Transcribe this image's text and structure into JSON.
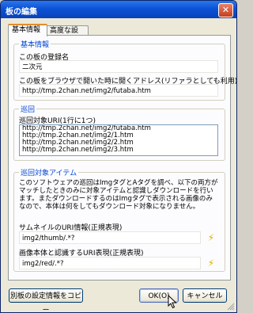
{
  "window": {
    "title": "板の編集",
    "close_label": "✕"
  },
  "tabs": [
    {
      "label": "基本情報",
      "active": true
    },
    {
      "label": "高度な設定",
      "active": false
    }
  ],
  "basic": {
    "group_title": "基本情報",
    "name_label": "この板の登録名",
    "name_value": "二次元",
    "url_label": "この板をブラウザで開いた時に開くアドレス(リファラとしても利用)",
    "url_value": "http://tmp.2chan.net/img2/futaba.htm"
  },
  "patrol": {
    "group_title": "巡回",
    "uri_label": "巡回対象URI(1行に1つ)",
    "uris": [
      "http://tmp.2chan.net/img2/futaba.htm",
      "http://tmp.2chan.net/img2/1.htm",
      "http://tmp.2chan.net/img2/2.htm",
      "http://tmp.2chan.net/img2/3.htm"
    ]
  },
  "items": {
    "group_title": "巡回対象アイテム",
    "description": "このソフトウェアの巡回はImgタグとAタグを調べ、以下の両方がマッチしたときのみに対象アイテムと認識しダウンロードを行います。またダウンロードするのはImgタグで表示される画像のみなので、本体は何をしてもダウンロード対象になりません。",
    "thumb_label": "サムネイルのURI情報(正規表現)",
    "thumb_value": "img2/thumb/.*?",
    "body_label": "画像本体と認識するURI表現(正規表現)",
    "body_value": "img2/red/.*?"
  },
  "footer": {
    "copy_button": "別板の設定情報をコピー",
    "ok_button": "OK(O)",
    "cancel_button": "キャンセル"
  },
  "icons": {
    "bolt": "⚡"
  }
}
